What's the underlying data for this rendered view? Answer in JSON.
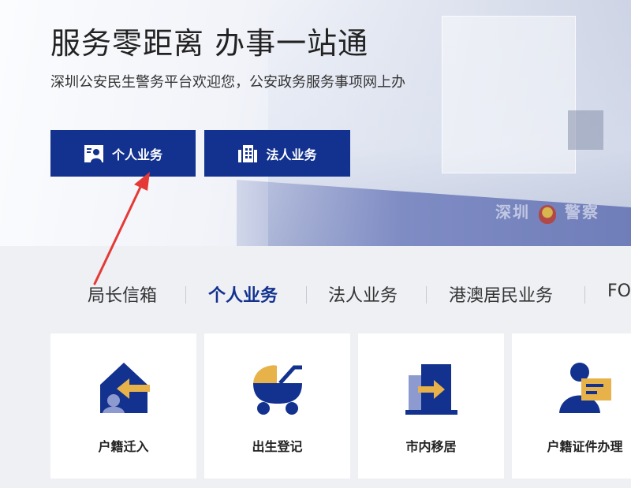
{
  "hero": {
    "title": "服务零距离 办事一站通",
    "subtitle": "深圳公安民生警务平台欢迎您，公安政务服务事项网上办",
    "band_text_left": "深圳",
    "band_text_right": "警察"
  },
  "buttons": {
    "personal": {
      "label": "个人业务",
      "icon": "person-card-icon"
    },
    "corporate": {
      "label": "法人业务",
      "icon": "building-icon"
    }
  },
  "tabs": [
    {
      "label": "局长信箱",
      "active": false
    },
    {
      "label": "个人业务",
      "active": true
    },
    {
      "label": "法人业务",
      "active": false
    },
    {
      "label": "港澳居民业务",
      "active": false
    },
    {
      "label": "FO",
      "active": false
    }
  ],
  "cards": [
    {
      "label": "户籍迁入",
      "icon": "household-move-in-icon"
    },
    {
      "label": "出生登记",
      "icon": "baby-carriage-icon"
    },
    {
      "label": "市内移居",
      "icon": "city-relocation-icon"
    },
    {
      "label": "户籍证件办理",
      "icon": "id-document-icon"
    }
  ],
  "colors": {
    "primary": "#13328f",
    "accent": "#e8b24a",
    "annotation": "#e53935",
    "background": "#eef0f4"
  }
}
